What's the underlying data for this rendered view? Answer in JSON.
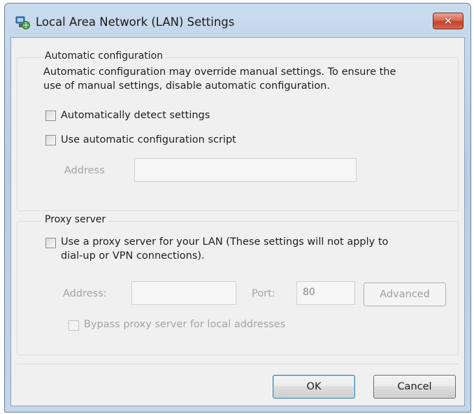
{
  "window": {
    "title": "Local Area Network (LAN) Settings",
    "icon": "network-settings-icon",
    "close_glyph": "✕"
  },
  "automatic_configuration": {
    "group_label": "Automatic configuration",
    "description_line1": "Automatic configuration may override manual settings.  To ensure the",
    "description_line2": "use of manual settings, disable automatic configuration.",
    "detect_settings": {
      "label": "Automatically detect settings",
      "checked": false
    },
    "use_script": {
      "label": "Use automatic configuration script",
      "checked": false
    },
    "address_label": "Address",
    "address_value": ""
  },
  "proxy_server": {
    "group_label": "Proxy server",
    "use_proxy_line1": "Use a proxy server for your LAN (These settings will not apply to",
    "use_proxy_line2": "dial-up or VPN connections).",
    "use_proxy_checked": false,
    "address_label": "Address:",
    "address_value": "",
    "port_label": "Port:",
    "port_value": "80",
    "advanced_label": "Advanced",
    "bypass_label": "Bypass proxy server for local addresses",
    "bypass_checked": false
  },
  "buttons": {
    "ok_label": "OK",
    "cancel_label": "Cancel"
  },
  "colors": {
    "title_bar": "#c3d6ea",
    "close_button": "#d2553f",
    "dialog_face": "#f0f0f0"
  }
}
